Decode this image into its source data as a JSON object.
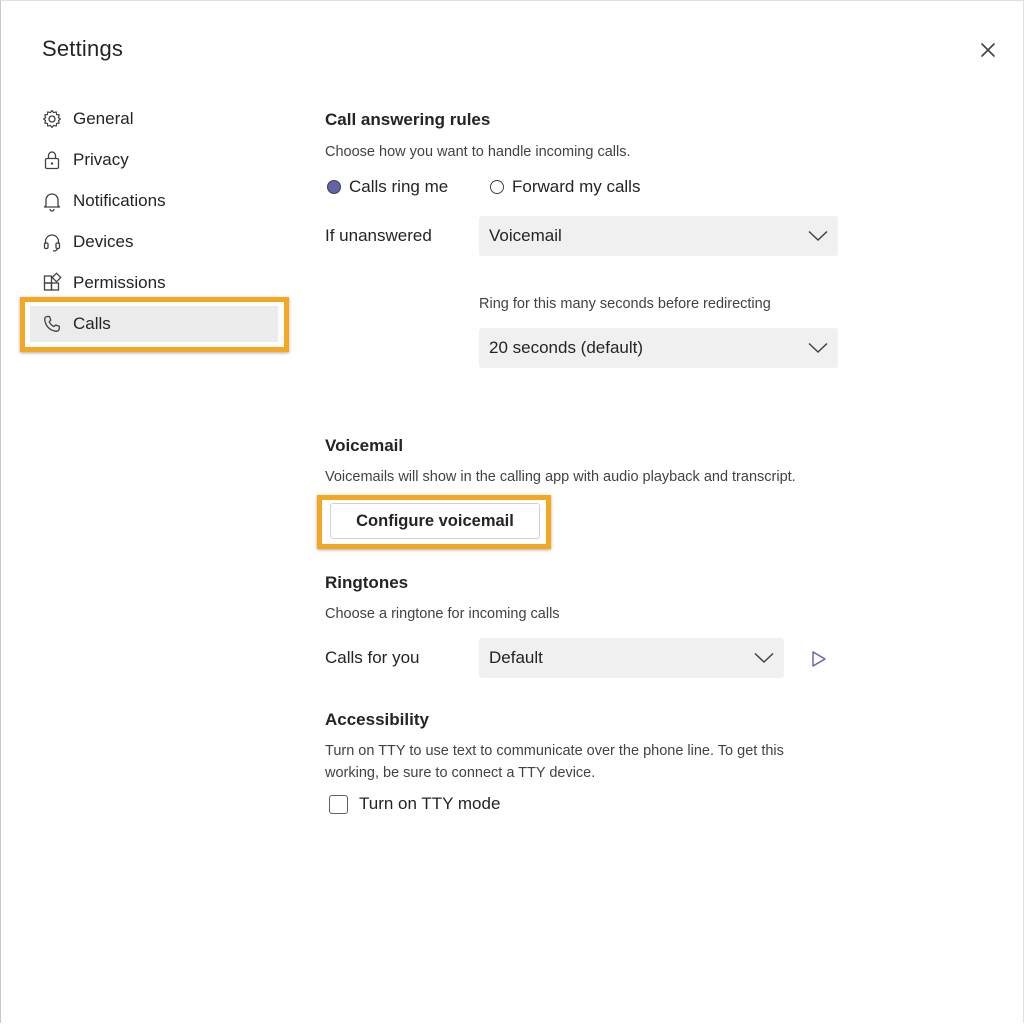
{
  "dialog": {
    "title": "Settings"
  },
  "sidebar": {
    "items": [
      {
        "label": "General",
        "icon": "gear-icon"
      },
      {
        "label": "Privacy",
        "icon": "lock-icon"
      },
      {
        "label": "Notifications",
        "icon": "bell-icon"
      },
      {
        "label": "Devices",
        "icon": "headset-icon"
      },
      {
        "label": "Permissions",
        "icon": "apps-icon"
      },
      {
        "label": "Calls",
        "icon": "phone-icon",
        "active": true
      }
    ]
  },
  "call_answering": {
    "heading": "Call answering rules",
    "description": "Choose how you want to handle incoming calls.",
    "options": [
      {
        "label": "Calls ring me",
        "selected": true
      },
      {
        "label": "Forward my calls",
        "selected": false
      }
    ],
    "if_unanswered_label": "If unanswered",
    "if_unanswered_value": "Voicemail",
    "ring_seconds_label": "Ring for this many seconds before redirecting",
    "ring_seconds_value": "20 seconds (default)"
  },
  "voicemail": {
    "heading": "Voicemail",
    "description": "Voicemails will show in the calling app with audio playback and transcript.",
    "button_label": "Configure voicemail"
  },
  "ringtones": {
    "heading": "Ringtones",
    "description": "Choose a ringtone for incoming calls",
    "calls_for_you_label": "Calls for you",
    "calls_for_you_value": "Default"
  },
  "accessibility": {
    "heading": "Accessibility",
    "description": "Turn on TTY to use text to communicate over the phone line. To get this working, be sure to connect a TTY device.",
    "tty_label": "Turn on TTY mode",
    "tty_checked": false
  },
  "colors": {
    "highlight": "#f5a623",
    "accent": "#6264a7",
    "select_bg": "#f0f0f0"
  }
}
